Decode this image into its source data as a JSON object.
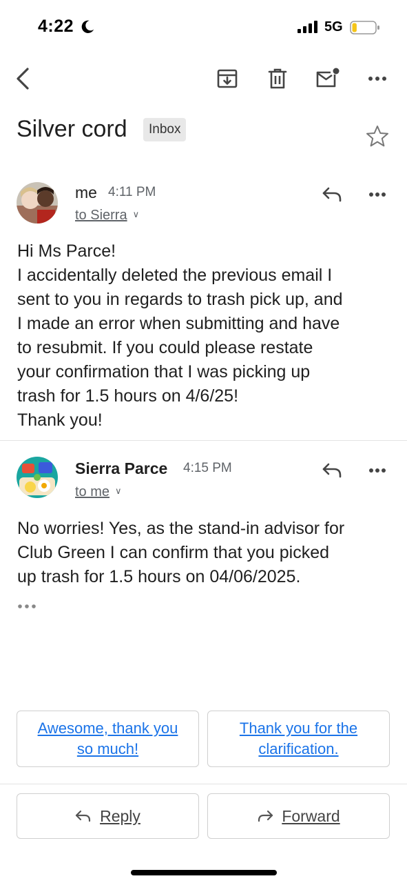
{
  "status_bar": {
    "time": "4:22",
    "network": "5G",
    "battery_level": 0.2,
    "icons": [
      "moon-icon",
      "signal-icon",
      "battery-icon"
    ]
  },
  "toolbar": {
    "icons": [
      "back-arrow-icon",
      "archive-icon",
      "trash-icon",
      "mark-unread-icon",
      "more-icon"
    ]
  },
  "thread": {
    "subject": "Silver cord",
    "label": "Inbox"
  },
  "messages": [
    {
      "sender": "me",
      "time": "4:11 PM",
      "recipients": "to Sierra",
      "body": [
        "Hi Ms Parce!",
        "I accidentally deleted the previous email I",
        "sent to you in regards to trash pick up, and",
        "I made an error when submitting and have",
        "to resubmit. If you could please restate",
        "your confirmation that I was picking up",
        "trash for 1.5 hours on 4/6/25!",
        "Thank you!"
      ]
    },
    {
      "sender": "Sierra Parce",
      "time": "4:15 PM",
      "recipients": "to me",
      "body": [
        "No worries! Yes, as the stand-in advisor for",
        "Club Green I can confirm that you picked",
        "up trash for 1.5 hours on 04/06/2025."
      ]
    }
  ],
  "smart_replies": [
    [
      "Awesome, thank you",
      "so much!"
    ],
    [
      "Thank you for the",
      "clarification."
    ]
  ],
  "actions": {
    "reply": "Reply",
    "forward": "Forward"
  },
  "colors": {
    "link_blue": "#1a73e8",
    "text": "#1f1f1f",
    "secondary": "#5f6368",
    "chip_bg": "#e8e8e8",
    "battery_fill": "#f5c518"
  }
}
